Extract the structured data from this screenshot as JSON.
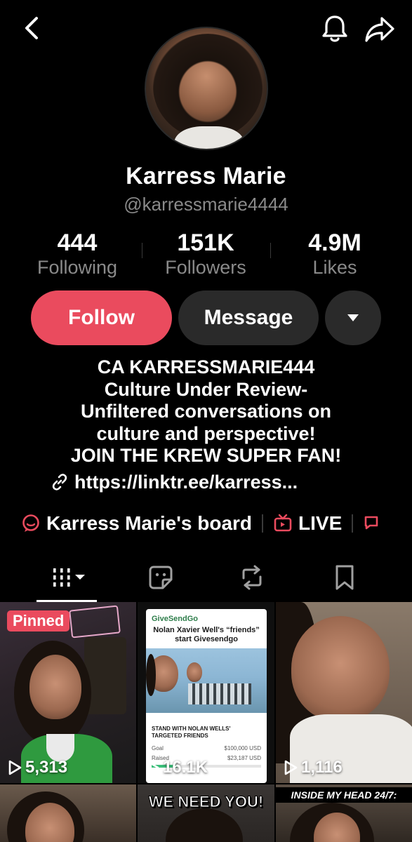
{
  "header": {
    "back_icon": "chevron-left-icon",
    "bell_icon": "bell-icon",
    "share_icon": "share-arrow-icon"
  },
  "profile": {
    "name": "Karress Marie",
    "handle": "@karressmarie4444"
  },
  "stats": [
    {
      "value": "444",
      "label": "Following"
    },
    {
      "value": "151K",
      "label": "Followers"
    },
    {
      "value": "4.9M",
      "label": "Likes"
    }
  ],
  "actions": {
    "follow_label": "Follow",
    "message_label": "Message",
    "more_icon": "triangle-down-icon"
  },
  "bio": {
    "lines": [
      "CA KARRESSMARIE444",
      "Culture Under Review-",
      "Unfiltered conversations on",
      "culture and perspective!",
      "JOIN THE KREW SUPER FAN!"
    ],
    "link": "https://linktr.ee/karress..."
  },
  "boards": {
    "board_label": "Karress Marie's board",
    "live_label": "LIVE"
  },
  "tabs": [
    {
      "icon": "grid-icon",
      "active": true
    },
    {
      "icon": "sticker-icon",
      "active": false
    },
    {
      "icon": "repost-icon",
      "active": false
    },
    {
      "icon": "bookmark-icon",
      "active": false
    }
  ],
  "videos": [
    {
      "views": "5,313",
      "pinned": "Pinned"
    },
    {
      "views": "16.1K",
      "card_brand": "GiveSendGo",
      "card_title": "Nolan Xavier Well's “friends” start Givesendgo",
      "card_heading": "STAND WITH NOLAN WELLS' TARGETED FRIENDS",
      "goal_label": "Goal",
      "goal_value": "$100,000 USD",
      "raised_label": "Raised",
      "raised_value": "$23,187 USD",
      "raised_fraction": 0.23
    },
    {
      "views": "1,116"
    },
    {
      "overlay": ""
    },
    {
      "overlay": "WE NEED YOU!"
    },
    {
      "overlay": "INSIDE MY HEAD 24/7:"
    }
  ],
  "colors": {
    "accent": "#ea4b5e",
    "muted": "#8a8a8a",
    "button_dark": "#2a2a2a"
  }
}
